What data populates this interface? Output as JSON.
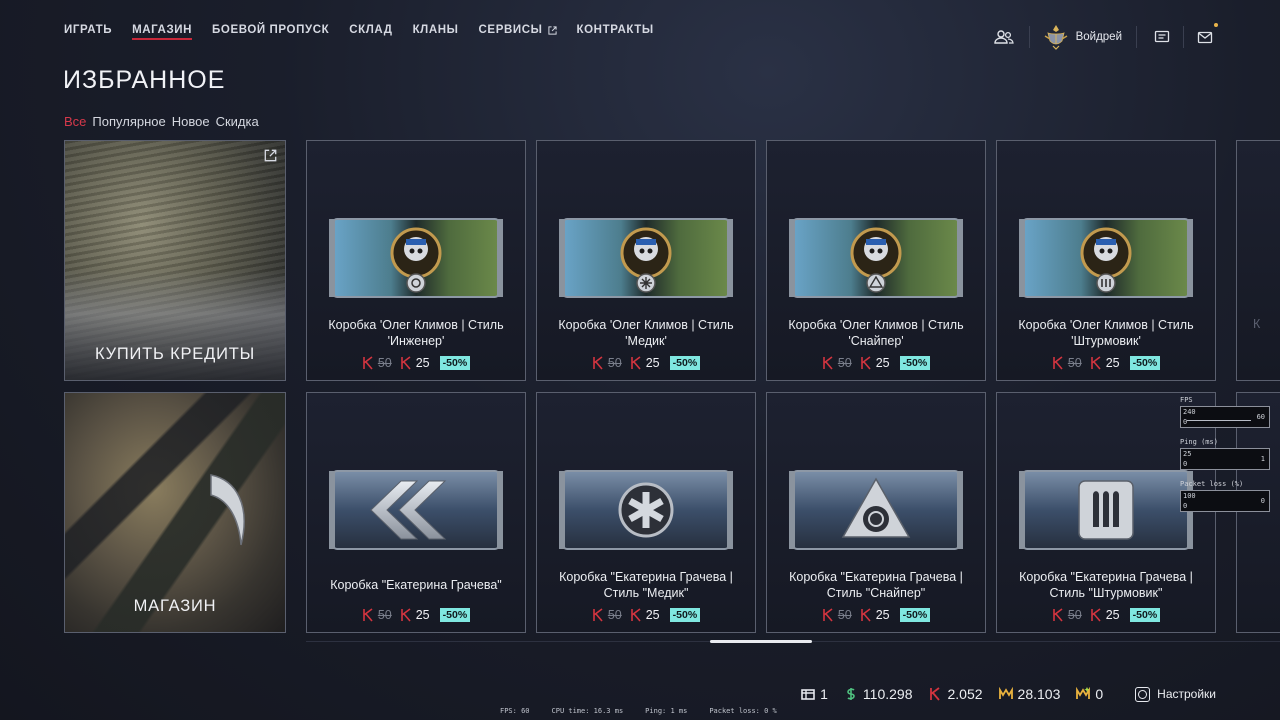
{
  "nav": {
    "items": [
      {
        "label": "ИГРАТЬ"
      },
      {
        "label": "МАГАЗИН",
        "active": true
      },
      {
        "label": "БОЕВОЙ ПРОПУСК"
      },
      {
        "label": "СКЛАД"
      },
      {
        "label": "КЛАНЫ"
      },
      {
        "label": "СЕРВИСЫ",
        "external": true
      },
      {
        "label": "КОНТРАКТЫ"
      }
    ]
  },
  "profile": {
    "name": "Войдрей"
  },
  "page_title": "ИЗБРАННОЕ",
  "filters": [
    {
      "label": "Все",
      "active": true
    },
    {
      "label": "Популярное"
    },
    {
      "label": "Новое"
    },
    {
      "label": "Скидка"
    }
  ],
  "big_tiles": {
    "buy_credits": {
      "label": "КУПИТЬ КРЕДИТЫ"
    },
    "shop": {
      "label": "МАГАЗИН"
    }
  },
  "items_row1": [
    {
      "name": "Коробка 'Олег Климов | Стиль 'Инженер'",
      "old_price": "50",
      "new_price": "25",
      "discount": "-50%"
    },
    {
      "name": "Коробка 'Олег Климов | Стиль 'Медик'",
      "old_price": "50",
      "new_price": "25",
      "discount": "-50%"
    },
    {
      "name": "Коробка 'Олег Климов | Стиль 'Снайпер'",
      "old_price": "50",
      "new_price": "25",
      "discount": "-50%"
    },
    {
      "name": "Коробка 'Олег Климов | Стиль 'Штурмовик'",
      "old_price": "50",
      "new_price": "25",
      "discount": "-50%"
    }
  ],
  "items_row2": [
    {
      "name": "Коробка \"Екатерина Грачева\"",
      "old_price": "50",
      "new_price": "25",
      "discount": "-50%"
    },
    {
      "name": "Коробка \"Екатерина Грачева | Стиль \"Медик\"",
      "old_price": "50",
      "new_price": "25",
      "discount": "-50%"
    },
    {
      "name": "Коробка \"Екатерина Грачева | Стиль \"Снайпер\"",
      "old_price": "50",
      "new_price": "25",
      "discount": "-50%"
    },
    {
      "name": "Коробка \"Екатерина Грачева | Стиль \"Штурмовик\"",
      "old_price": "50",
      "new_price": "25",
      "discount": "-50%"
    }
  ],
  "partial_tile": {
    "ghost_text": "К"
  },
  "perf_overlay": {
    "fps": {
      "title": "FPS",
      "max": "240",
      "min": "0",
      "value": "60"
    },
    "ping": {
      "title": "Ping (ms)",
      "max": "25",
      "min": "0",
      "value": "1"
    },
    "loss": {
      "title": "Packet loss (%)",
      "max": "100",
      "min": "0",
      "value": "0"
    }
  },
  "currencies": {
    "crates": "1",
    "warbucks": "110.298",
    "kredits": "2.052",
    "crowns": "28.103",
    "battlepass": "0"
  },
  "settings_label": "Настройки",
  "statusbar": {
    "fps": "FPS: 60",
    "cpu": "CPU time: 16.3 ms",
    "ping": "Ping: 1 ms",
    "loss": "Packet loss: 0 %"
  },
  "colors": {
    "accent_red": "#c8283a",
    "discount_bg": "#7fe7e0",
    "bg": "#1a1e2b"
  }
}
